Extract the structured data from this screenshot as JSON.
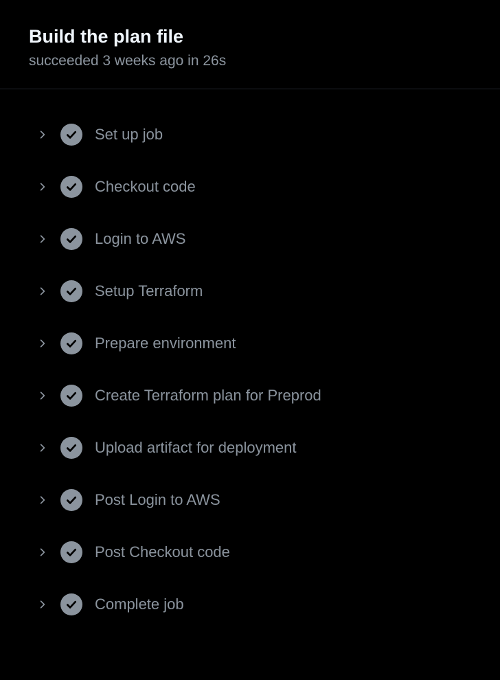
{
  "header": {
    "title": "Build the plan file",
    "status_line": "succeeded 3 weeks ago in 26s"
  },
  "steps": [
    {
      "label": "Set up job"
    },
    {
      "label": "Checkout code"
    },
    {
      "label": "Login to AWS"
    },
    {
      "label": "Setup Terraform"
    },
    {
      "label": "Prepare environment"
    },
    {
      "label": "Create Terraform plan for Preprod"
    },
    {
      "label": "Upload artifact for deployment"
    },
    {
      "label": "Post Login to AWS"
    },
    {
      "label": "Post Checkout code"
    },
    {
      "label": "Complete job"
    }
  ]
}
